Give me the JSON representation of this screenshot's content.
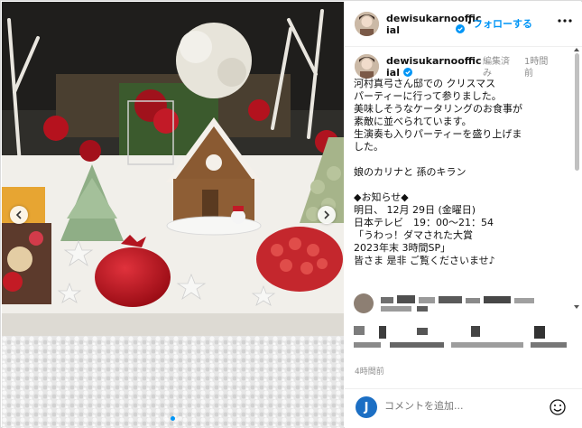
{
  "post": {
    "username_line1": "dewisukarnooffic",
    "username_line2": "ial",
    "separator": "•",
    "follow_label": "フォローする",
    "edited_line1": "編集済",
    "edited_line2": "み",
    "time_line1": "1時間",
    "time_line2": "前",
    "caption": "河村真弓さん邸での クリスマス\nパーティーに行って参りました。\n美味しそうなケータリングのお食事が\n素敵に並べられています。\n生演奏も入りパーティーを盛り上げま\nした。\n\n娘のカリナと 孫のキラン\n\n◆お知らせ◆\n明日、 12月 29日 (金曜日)\n日本テレビ　19：00〜21：54\n「うわっ！ダマされた大賞\n2023年末 3時間SP」\n皆さま 是非 ご覧くださいませ♪",
    "posted_ago": "4時間前"
  },
  "footer": {
    "avatar_letter": "J",
    "comment_placeholder": "コメントを追加..."
  },
  "icons": {
    "verified": "verified-badge-icon",
    "more": "more-options-icon",
    "emoji": "emoji-icon",
    "prev": "chevron-left-icon",
    "next": "chevron-right-icon"
  },
  "colors": {
    "accent": "#0095f6",
    "secondary_text": "#8e8e8e",
    "avatar_blue": "#1c6fc4"
  }
}
